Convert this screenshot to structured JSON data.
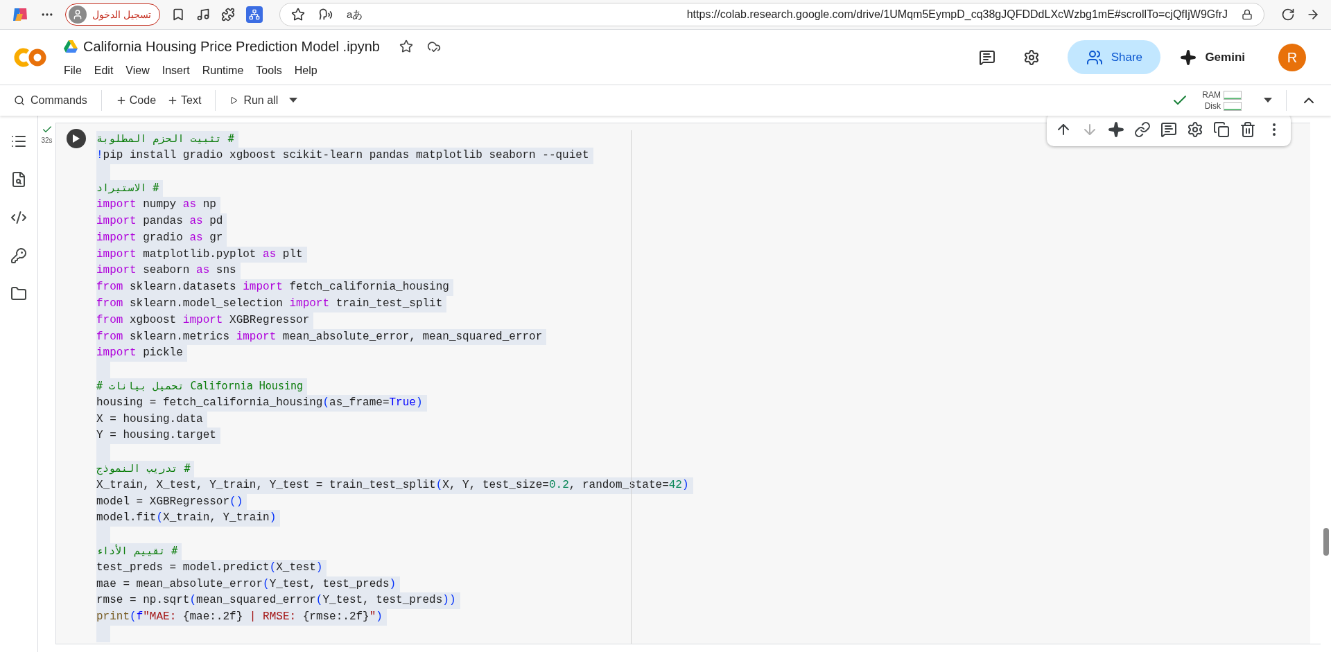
{
  "browser": {
    "signin_button": "تسجيل الدخول",
    "translate_glyph": "aあ",
    "url": "https://colab.research.google.com/drive/1UMqm5EympD_cq38gJQFDDdLXcWzbg1mE#scrollTo=cjQfIjW9GfrJ"
  },
  "notebook": {
    "title": "California Housing Price Prediction Model .ipynb",
    "menu": [
      "File",
      "Edit",
      "View",
      "Insert",
      "Runtime",
      "Tools",
      "Help"
    ],
    "share": "Share",
    "gemini": "Gemini",
    "avatar": "R"
  },
  "toolbar": {
    "commands": "Commands",
    "add_code": "Code",
    "add_text": "Text",
    "run_all": "Run all",
    "connected": true,
    "meters": [
      "RAM",
      "Disk"
    ]
  },
  "sidebar": {
    "items": [
      {
        "kind": "toc"
      },
      {
        "kind": "find"
      },
      {
        "kind": "snippets"
      },
      {
        "kind": "secrets"
      },
      {
        "kind": "files"
      }
    ]
  },
  "cell": {
    "executed": true,
    "status": "32s",
    "actions": [
      {
        "kind": "up",
        "disabled": false
      },
      {
        "kind": "down",
        "disabled": true
      },
      {
        "kind": "gemini",
        "disabled": false
      },
      {
        "kind": "link",
        "disabled": false
      },
      {
        "kind": "comment",
        "disabled": false
      },
      {
        "kind": "settings",
        "disabled": false
      },
      {
        "kind": "mirror",
        "disabled": false
      },
      {
        "kind": "delete",
        "disabled": false
      },
      {
        "kind": "more",
        "disabled": false
      }
    ],
    "lines": [
      {
        "kind": "code",
        "tokens": [
          {
            "kind": "comment",
            "text": "تثبيت الحزم المطلوبة #"
          }
        ]
      },
      {
        "kind": "code",
        "tokens": [
          {
            "kind": "paren",
            "text": "!"
          },
          {
            "kind": "plain",
            "text": "pip install gradio xgboost scikit-learn pandas matplotlib seaborn --quiet"
          }
        ]
      },
      {
        "kind": "blank"
      },
      {
        "kind": "code",
        "tokens": [
          {
            "kind": "comment",
            "text": "الاستيراد #"
          }
        ]
      },
      {
        "kind": "code",
        "tokens": [
          {
            "kind": "kw",
            "text": "import"
          },
          {
            "kind": "plain",
            "text": " numpy "
          },
          {
            "kind": "kw",
            "text": "as"
          },
          {
            "kind": "plain",
            "text": " np"
          }
        ]
      },
      {
        "kind": "code",
        "tokens": [
          {
            "kind": "kw",
            "text": "import"
          },
          {
            "kind": "plain",
            "text": " pandas "
          },
          {
            "kind": "kw",
            "text": "as"
          },
          {
            "kind": "plain",
            "text": " pd"
          }
        ]
      },
      {
        "kind": "code",
        "tokens": [
          {
            "kind": "kw",
            "text": "import"
          },
          {
            "kind": "plain",
            "text": " gradio "
          },
          {
            "kind": "kw",
            "text": "as"
          },
          {
            "kind": "plain",
            "text": " gr"
          }
        ]
      },
      {
        "kind": "code",
        "tokens": [
          {
            "kind": "kw",
            "text": "import"
          },
          {
            "kind": "plain",
            "text": " matplotlib.pyplot "
          },
          {
            "kind": "kw",
            "text": "as"
          },
          {
            "kind": "plain",
            "text": " plt"
          }
        ]
      },
      {
        "kind": "code",
        "tokens": [
          {
            "kind": "kw",
            "text": "import"
          },
          {
            "kind": "plain",
            "text": " seaborn "
          },
          {
            "kind": "kw",
            "text": "as"
          },
          {
            "kind": "plain",
            "text": " sns"
          }
        ]
      },
      {
        "kind": "code",
        "tokens": [
          {
            "kind": "kw",
            "text": "from"
          },
          {
            "kind": "plain",
            "text": " sklearn.datasets "
          },
          {
            "kind": "kw",
            "text": "import"
          },
          {
            "kind": "plain",
            "text": " fetch_california_housing"
          }
        ]
      },
      {
        "kind": "code",
        "tokens": [
          {
            "kind": "kw",
            "text": "from"
          },
          {
            "kind": "plain",
            "text": " sklearn.model_selection "
          },
          {
            "kind": "kw",
            "text": "import"
          },
          {
            "kind": "plain",
            "text": " train_test_split"
          }
        ]
      },
      {
        "kind": "code",
        "tokens": [
          {
            "kind": "kw",
            "text": "from"
          },
          {
            "kind": "plain",
            "text": " xgboost "
          },
          {
            "kind": "kw",
            "text": "import"
          },
          {
            "kind": "plain",
            "text": " XGBRegressor"
          }
        ]
      },
      {
        "kind": "code",
        "tokens": [
          {
            "kind": "kw",
            "text": "from"
          },
          {
            "kind": "plain",
            "text": " sklearn.metrics "
          },
          {
            "kind": "kw",
            "text": "import"
          },
          {
            "kind": "plain",
            "text": " mean_absolute_error, mean_squared_error"
          }
        ]
      },
      {
        "kind": "code",
        "tokens": [
          {
            "kind": "kw",
            "text": "import"
          },
          {
            "kind": "plain",
            "text": " pickle"
          }
        ]
      },
      {
        "kind": "blank"
      },
      {
        "kind": "code",
        "tokens": [
          {
            "kind": "comment",
            "text": "# تحميل بيانات California Housing"
          }
        ]
      },
      {
        "kind": "code",
        "tokens": [
          {
            "kind": "plain",
            "text": "housing = fetch_california_housing"
          },
          {
            "kind": "paren",
            "text": "("
          },
          {
            "kind": "plain",
            "text": "as_frame="
          },
          {
            "kind": "const",
            "text": "True"
          },
          {
            "kind": "paren",
            "text": ")"
          }
        ]
      },
      {
        "kind": "code",
        "tokens": [
          {
            "kind": "plain",
            "text": "X = housing.data"
          }
        ]
      },
      {
        "kind": "code",
        "tokens": [
          {
            "kind": "plain",
            "text": "Y = housing.target"
          }
        ]
      },
      {
        "kind": "blank"
      },
      {
        "kind": "code",
        "tokens": [
          {
            "kind": "comment",
            "text": "تدريب النموذج #"
          }
        ]
      },
      {
        "kind": "code",
        "tokens": [
          {
            "kind": "plain",
            "text": "X_train, X_test, Y_train, Y_test = train_test_split"
          },
          {
            "kind": "paren",
            "text": "("
          },
          {
            "kind": "plain",
            "text": "X, Y, test_size="
          },
          {
            "kind": "num",
            "text": "0.2"
          },
          {
            "kind": "plain",
            "text": ", random_state="
          },
          {
            "kind": "num",
            "text": "42"
          },
          {
            "kind": "paren",
            "text": ")"
          }
        ]
      },
      {
        "kind": "code",
        "tokens": [
          {
            "kind": "plain",
            "text": "model = XGBRegressor"
          },
          {
            "kind": "paren",
            "text": "()"
          }
        ]
      },
      {
        "kind": "code",
        "tokens": [
          {
            "kind": "plain",
            "text": "model.fit"
          },
          {
            "kind": "paren",
            "text": "("
          },
          {
            "kind": "plain",
            "text": "X_train, Y_train"
          },
          {
            "kind": "paren",
            "text": ")"
          }
        ]
      },
      {
        "kind": "blank"
      },
      {
        "kind": "code",
        "tokens": [
          {
            "kind": "comment",
            "text": "تقييم الأداء #"
          }
        ]
      },
      {
        "kind": "code",
        "tokens": [
          {
            "kind": "plain",
            "text": "test_preds = model.predict"
          },
          {
            "kind": "paren",
            "text": "("
          },
          {
            "kind": "plain",
            "text": "X_test"
          },
          {
            "kind": "paren",
            "text": ")"
          }
        ]
      },
      {
        "kind": "code",
        "tokens": [
          {
            "kind": "plain",
            "text": "mae = mean_absolute_error"
          },
          {
            "kind": "paren",
            "text": "("
          },
          {
            "kind": "plain",
            "text": "Y_test, test_preds"
          },
          {
            "kind": "paren",
            "text": ")"
          }
        ]
      },
      {
        "kind": "code",
        "tokens": [
          {
            "kind": "plain",
            "text": "rmse = np.sqrt"
          },
          {
            "kind": "paren",
            "text": "("
          },
          {
            "kind": "plain",
            "text": "mean_squared_error"
          },
          {
            "kind": "paren",
            "text": "("
          },
          {
            "kind": "plain",
            "text": "Y_test, test_preds"
          },
          {
            "kind": "paren",
            "text": "))"
          }
        ]
      },
      {
        "kind": "code",
        "tokens": [
          {
            "kind": "func",
            "text": "print"
          },
          {
            "kind": "paren",
            "text": "("
          },
          {
            "kind": "const",
            "text": "f"
          },
          {
            "kind": "str",
            "text": "\"MAE: "
          },
          {
            "kind": "plain",
            "text": "{mae:.2f}"
          },
          {
            "kind": "str",
            "text": " | RMSE: "
          },
          {
            "kind": "plain",
            "text": "{rmse:.2f}"
          },
          {
            "kind": "str",
            "text": "\""
          },
          {
            "kind": "paren",
            "text": ")"
          }
        ]
      },
      {
        "kind": "blank"
      }
    ]
  }
}
